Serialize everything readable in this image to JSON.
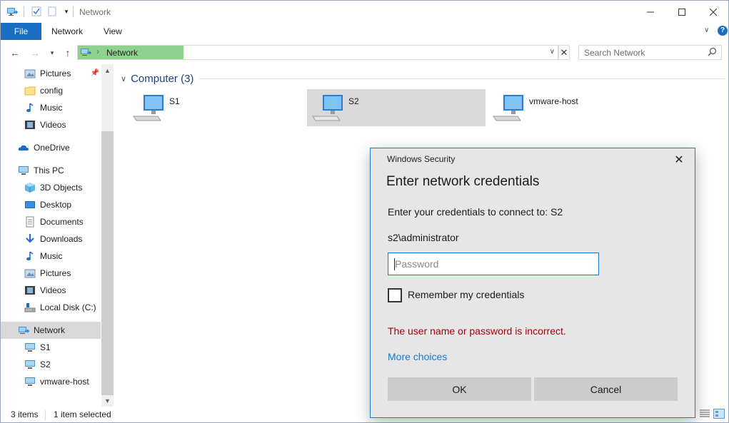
{
  "window": {
    "title": "Network"
  },
  "ribbon": {
    "tabs": [
      "File",
      "Network",
      "View"
    ]
  },
  "address": {
    "path": "Network"
  },
  "search": {
    "placeholder": "Search Network"
  },
  "sidebar": {
    "items": [
      {
        "label": "Pictures",
        "icon": "pictures-icon"
      },
      {
        "label": "config",
        "icon": "folder-icon"
      },
      {
        "label": "Music",
        "icon": "music-icon"
      },
      {
        "label": "Videos",
        "icon": "videos-icon"
      },
      {
        "label": "OneDrive",
        "icon": "cloud-icon"
      },
      {
        "label": "This PC",
        "icon": "pc-icon"
      },
      {
        "label": "3D Objects",
        "icon": "cube-icon"
      },
      {
        "label": "Desktop",
        "icon": "desktop-icon"
      },
      {
        "label": "Documents",
        "icon": "documents-icon"
      },
      {
        "label": "Downloads",
        "icon": "download-icon"
      },
      {
        "label": "Music",
        "icon": "music-icon"
      },
      {
        "label": "Pictures",
        "icon": "pictures-icon"
      },
      {
        "label": "Videos",
        "icon": "videos-icon"
      },
      {
        "label": "Local Disk (C:)",
        "icon": "disk-icon"
      },
      {
        "label": "Network",
        "icon": "network-icon"
      },
      {
        "label": "S1",
        "icon": "computer-icon"
      },
      {
        "label": "S2",
        "icon": "computer-icon"
      },
      {
        "label": "vmware-host",
        "icon": "computer-icon"
      }
    ]
  },
  "content": {
    "group": "Computer (3)",
    "computers": [
      "S1",
      "S2",
      "vmware-host"
    ]
  },
  "status": {
    "count": "3 items",
    "selection": "1 item selected"
  },
  "dialog": {
    "window_title": "Windows Security",
    "heading": "Enter network credentials",
    "prompt": "Enter your credentials to connect to: S2",
    "username": "s2\\administrator",
    "password_placeholder": "Password",
    "remember_label": "Remember my credentials",
    "error": "The user name or password is incorrect.",
    "more_choices": "More choices",
    "ok_label": "OK",
    "cancel_label": "Cancel"
  },
  "colors": {
    "accent": "#1979ca",
    "file_tab": "#1a6dc2",
    "address_progress": "#8ed28d",
    "error": "#a8000a",
    "group_header": "#1e3f87"
  }
}
